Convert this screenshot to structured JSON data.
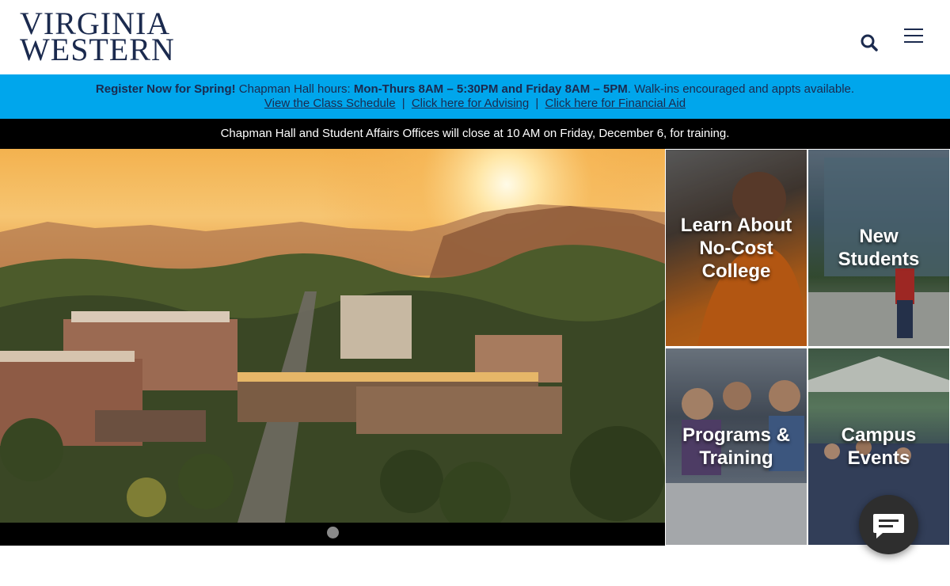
{
  "header": {
    "logo_line1": "VIRGINIA",
    "logo_line2": "WESTERN",
    "search_icon": "search-icon",
    "menu_icon": "hamburger-menu-icon"
  },
  "alert": {
    "lead": "Register Now for Spring!",
    "hours_label": "Chapman Hall hours:",
    "hours_value": "Mon-Thurs 8AM – 5:30PM and Friday 8AM – 5PM",
    "walkins": ". Walk-ins encouraged and appts available.",
    "links": [
      "View the Class Schedule",
      "Click here for Advising",
      "Click here for Financial Aid"
    ],
    "separator": "|"
  },
  "notice": {
    "text": "Chapman Hall and Student Affairs Offices will close at 10 AM on Friday, December 6, for training."
  },
  "tiles": [
    {
      "line1": "Learn About",
      "line2": "No-Cost",
      "line3": "College"
    },
    {
      "line1": "New",
      "line2": "Students"
    },
    {
      "line1": "Programs &",
      "line2": "Training"
    },
    {
      "line1": "Campus",
      "line2": "Events"
    }
  ],
  "colors": {
    "brand_navy": "#1b2a4e",
    "alert_blue": "#00a6ec",
    "notice_black": "#000000"
  },
  "chat": {
    "icon": "chat-bubble-icon"
  }
}
